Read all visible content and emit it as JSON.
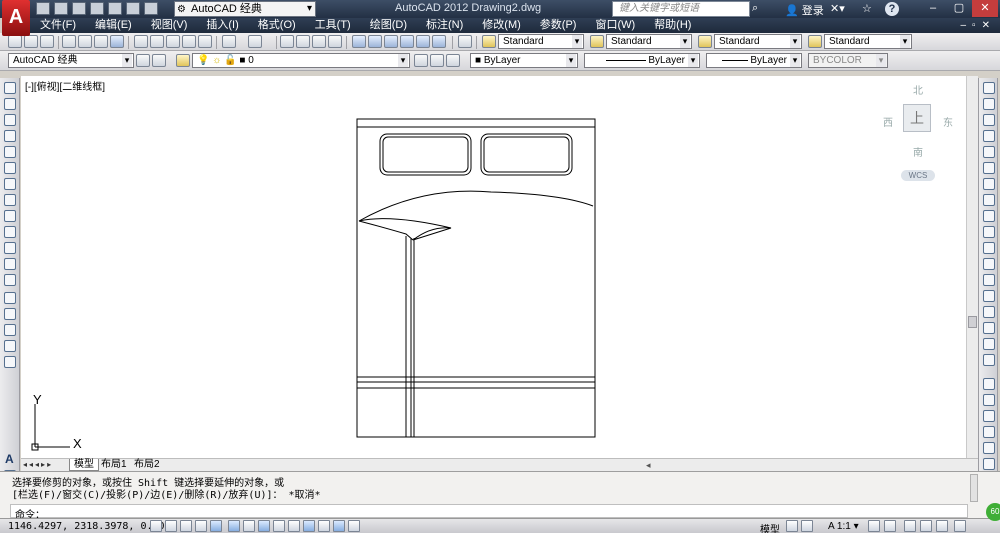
{
  "titlebar": {
    "logo": "A",
    "workspace": "AutoCAD 经典",
    "window_title": "AutoCAD 2012    Drawing2.dwg",
    "search_placeholder": "键入关键字或短语",
    "login": "登录",
    "help": "?"
  },
  "menubar": {
    "items": [
      "文件(F)",
      "编辑(E)",
      "视图(V)",
      "插入(I)",
      "格式(O)",
      "工具(T)",
      "绘图(D)",
      "标注(N)",
      "修改(M)",
      "参数(P)",
      "窗口(W)",
      "帮助(H)"
    ]
  },
  "toolbar1": {
    "text_style": "Standard",
    "dim_style": "Standard",
    "table_style": "Standard",
    "multileader_style": "Standard"
  },
  "toolbar2": {
    "workspace": "AutoCAD 经典",
    "layer": "0",
    "color": "ByLayer",
    "linetype": "ByLayer",
    "lineweight": "ByLayer",
    "plotstyle": "BYCOLOR"
  },
  "viewport": {
    "label": "[-][俯视][二维线框]"
  },
  "viewcube": {
    "north": "北",
    "south": "南",
    "east": "东",
    "west": "西",
    "top": "上",
    "wcs": "WCS"
  },
  "ucs": {
    "x_label": "X",
    "y_label": "Y"
  },
  "tabs": {
    "nav": "◂◂◂▸▸",
    "model": "模型",
    "layout1": "布局1",
    "layout2": "布局2"
  },
  "command": {
    "line1": "选择要修剪的对象，或按住 Shift 键选择要延伸的对象，或",
    "line2": "[栏选(F)/窗交(C)/投影(P)/边(E)/删除(R)/放弃(U)]： *取消*",
    "prompt": "命令："
  },
  "statusbar": {
    "coords": "1146.4297, 2318.3978, 0.0000",
    "model": "模型",
    "scale": "A 1:1 ▾",
    "badge": "60"
  }
}
